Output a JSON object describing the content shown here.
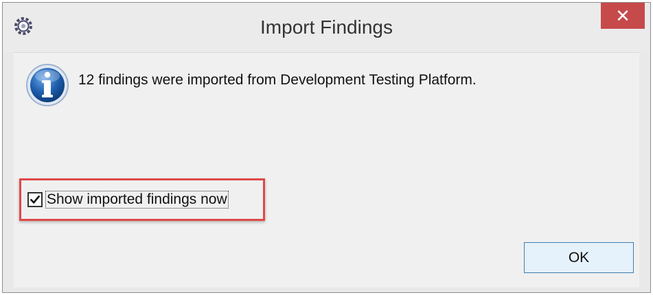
{
  "window": {
    "title": "Import Findings",
    "close_label": "✕"
  },
  "message": {
    "text": "12 findings were imported from Development Testing Platform."
  },
  "checkbox": {
    "label": "Show imported findings now",
    "checked": true
  },
  "buttons": {
    "ok_label": "OK"
  },
  "colors": {
    "close_button": "#c74a4a",
    "highlight_border": "#e04848",
    "ok_border": "#3c7fb1",
    "info_icon": "#1f5fae"
  },
  "icons": {
    "app": "gear-icon",
    "info": "info-icon",
    "check": "checkmark-icon"
  }
}
